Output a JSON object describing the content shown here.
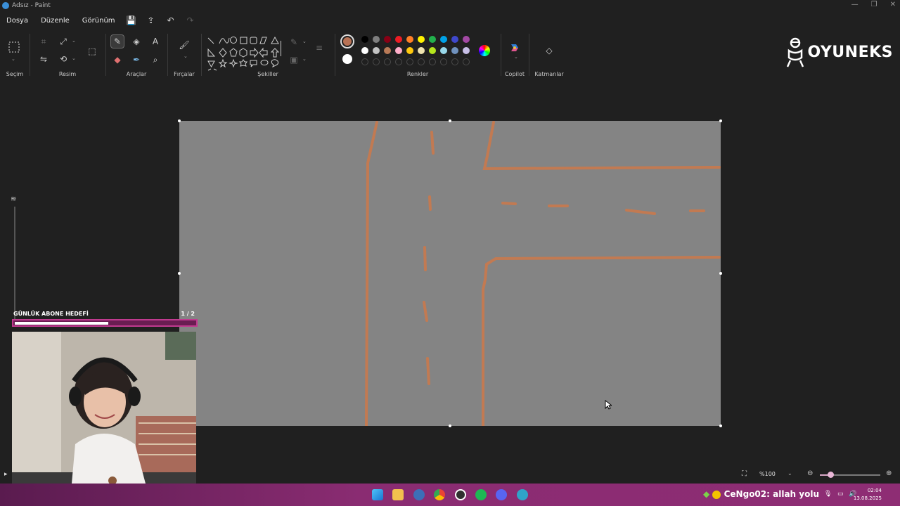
{
  "window": {
    "title": "Adsız - Paint"
  },
  "menu": {
    "file": "Dosya",
    "edit": "Düzenle",
    "view": "Görünüm"
  },
  "ribbon": {
    "groups": {
      "selection": "Seçim",
      "image": "Resim",
      "tools": "Araçlar",
      "brushes": "Fırçalar",
      "shapes": "Şekiller",
      "colors": "Renkler",
      "copilot": "Copilot",
      "layers": "Katmanlar"
    },
    "primary_color": "#b87255",
    "secondary_color": "#ffffff",
    "palette_row1": [
      "#000000",
      "#7f7f7f",
      "#880015",
      "#ed1c24",
      "#ff7f27",
      "#fff200",
      "#22b14c",
      "#00a2e8",
      "#3f48cc",
      "#a349a4"
    ],
    "palette_row2": [
      "#ffffff",
      "#c3c3c3",
      "#b97a57",
      "#ffaec9",
      "#ffc90e",
      "#efe4b0",
      "#b5e61d",
      "#99d9ea",
      "#7092be",
      "#c8bfe7"
    ]
  },
  "logo": {
    "text": "OYUNEKS"
  },
  "overlay": {
    "goal_title": "GÜNLÜK ABONE HEDEFİ",
    "goal_count": "1 / 2",
    "goal_progress": 0.5
  },
  "status": {
    "zoom": "%100"
  },
  "taskbar": {
    "chat_user": "CeNgo02",
    "chat_message": ": allah yolu",
    "time": "02:04",
    "date": "13.08.2025"
  },
  "canvas": {
    "background": "#848484",
    "stroke_color": "#c27a52"
  }
}
